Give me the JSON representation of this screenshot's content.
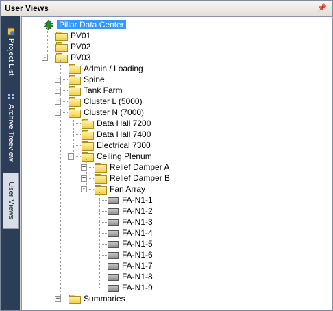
{
  "panel": {
    "title": "User Views",
    "pin_glyph": "☉"
  },
  "sidebar": {
    "tabs": [
      {
        "label": "Project List",
        "icon": "project-list-icon"
      },
      {
        "label": "Archive Treeview",
        "icon": "archive-treeview-icon"
      },
      {
        "label": "User Views",
        "icon": "",
        "active": true
      }
    ]
  },
  "tree": {
    "root": {
      "label": "Pillar Data Center",
      "icon": "tree-icon",
      "selected": true
    },
    "items": [
      {
        "label": "PV01",
        "icon": "folder-icon"
      },
      {
        "label": "PV02",
        "icon": "folder-icon"
      },
      {
        "label": "PV03",
        "icon": "folder-icon",
        "expander": "-"
      },
      {
        "label": "Admin / Loading",
        "icon": "folder-icon"
      },
      {
        "label": "Spine",
        "icon": "folder-icon",
        "expander": "+"
      },
      {
        "label": "Tank Farm",
        "icon": "folder-icon",
        "expander": "+"
      },
      {
        "label": "Cluster L (5000)",
        "icon": "folder-icon",
        "expander": "+"
      },
      {
        "label": "Cluster N (7000)",
        "icon": "folder-icon",
        "expander": "-"
      },
      {
        "label": "Data Hall 7200",
        "icon": "folder-icon"
      },
      {
        "label": "Data Hall 7400",
        "icon": "folder-icon"
      },
      {
        "label": "Electrical 7300",
        "icon": "folder-icon"
      },
      {
        "label": "Ceiling Plenum",
        "icon": "folder-icon",
        "expander": "-"
      },
      {
        "label": "Relief Damper A",
        "icon": "folder-icon",
        "expander": "+"
      },
      {
        "label": "Relief Damper B",
        "icon": "folder-icon",
        "expander": "+"
      },
      {
        "label": "Fan Array",
        "icon": "folder-icon",
        "expander": "-"
      },
      {
        "label": "FA-N1-1",
        "icon": "device-icon"
      },
      {
        "label": "FA-N1-2",
        "icon": "device-icon"
      },
      {
        "label": "FA-N1-3",
        "icon": "device-icon"
      },
      {
        "label": "FA-N1-4",
        "icon": "device-icon"
      },
      {
        "label": "FA-N1-5",
        "icon": "device-icon"
      },
      {
        "label": "FA-N1-6",
        "icon": "device-icon"
      },
      {
        "label": "FA-N1-7",
        "icon": "device-icon"
      },
      {
        "label": "FA-N1-8",
        "icon": "device-icon"
      },
      {
        "label": "FA-N1-9",
        "icon": "device-icon"
      },
      {
        "label": "Summaries",
        "icon": "folder-icon",
        "expander": "+"
      }
    ]
  },
  "colors": {
    "selection": "#3399ff",
    "sidebar": "#2b3d57",
    "folder": "#f2cf4b"
  }
}
